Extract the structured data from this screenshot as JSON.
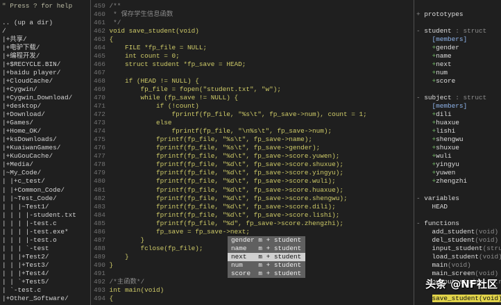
{
  "colors": {
    "background": "#1f1f1f",
    "tree_text": "#d4d4d4",
    "tree_hint": "#b9b9a2",
    "line_number": "#737373",
    "code": "#cfcb68",
    "comment": "#8b8b8b",
    "separator": "#505050",
    "popup_bg": "#606060",
    "popup_text": "#eeeeee",
    "popup_selected_bg": "#d0d0d0",
    "popup_selected_text": "#111111",
    "tag_text": "#dedede",
    "tag_dim": "#8e8e8e",
    "tag_group": "#8fb4ea",
    "tag_visibility": "#78c36a",
    "tag_current_bg": "#e2d44a",
    "tag_current_text": "#111111",
    "watermark": "#ffffff"
  },
  "nerdtree": {
    "lines": [
      "\" Press ? for help",
      "",
      ".. (up a dir)",
      "/",
      "|+共享/",
      "|+电驴下载/",
      "|+编程开发/",
      "|+$RECYCLE.BIN/",
      "|+baidu player/",
      "|+CloudCache/",
      "|+Cygwin/",
      "|+Cygwin_Download/",
      "|+desktop/",
      "|+Download/",
      "|+Games/",
      "|+Home_OK/",
      "|+ksDownloads/",
      "|+KuaiwanGames/",
      "|+KuGouCache/",
      "|+Media/",
      "|~My_Code/",
      "| |+c_test/",
      "| |+Common_Code/",
      "| |~Test_Code/",
      "| | |~Test1/",
      "| | | |-student.txt",
      "| | | |-test.c",
      "| | | |-test.exe*",
      "| | | |-test.o",
      "| | | `-test",
      "| | |+Test2/",
      "| | |+Test3/",
      "| | |+Test4/",
      "| | `+Test5/",
      "| `-test.c",
      "|+Other_Software/"
    ]
  },
  "editor": {
    "lines": [
      {
        "num": "459",
        "text": "/**",
        "comment": true
      },
      {
        "num": "460",
        "text": " * 保存学生信息函数",
        "comment": true
      },
      {
        "num": "461",
        "text": " */",
        "comment": true
      },
      {
        "num": "462",
        "text": "void save_student(void)"
      },
      {
        "num": "463",
        "text": "{"
      },
      {
        "num": "464",
        "text": "    FILE *fp_file = NULL;"
      },
      {
        "num": "465",
        "text": "    int count = 0;"
      },
      {
        "num": "466",
        "text": "    struct student *fp_save = HEAD;"
      },
      {
        "num": "467",
        "text": ""
      },
      {
        "num": "468",
        "text": "    if (HEAD != NULL) {"
      },
      {
        "num": "469",
        "text": "        fp_file = fopen(\"student.txt\", \"w\");"
      },
      {
        "num": "470",
        "text": "        while (fp_save != NULL) {"
      },
      {
        "num": "471",
        "text": "            if (!count)"
      },
      {
        "num": "472",
        "text": "                fprintf(fp_file, \"%s\\t\", fp_save->num), count = 1;"
      },
      {
        "num": "473",
        "text": "            else"
      },
      {
        "num": "474",
        "text": "                fprintf(fp_file, \"\\n%s\\t\", fp_save->num);"
      },
      {
        "num": "475",
        "text": "            fprintf(fp_file, \"%s\\t\", fp_save->name);"
      },
      {
        "num": "476",
        "text": "            fprintf(fp_file, \"%s\\t\", fp_save->gender);"
      },
      {
        "num": "477",
        "text": "            fprintf(fp_file, \"%d\\t\", fp_save->score.yuwen);"
      },
      {
        "num": "478",
        "text": "            fprintf(fp_file, \"%d\\t\", fp_save->score.shuxue);"
      },
      {
        "num": "479",
        "text": "            fprintf(fp_file, \"%d\\t\", fp_save->score.yingyu);"
      },
      {
        "num": "480",
        "text": "            fprintf(fp_file, \"%d\\t\", fp_save->score.wuli);"
      },
      {
        "num": "481",
        "text": "            fprintf(fp_file, \"%d\\t\", fp_save->score.huaxue);"
      },
      {
        "num": "482",
        "text": "            fprintf(fp_file, \"%d\\t\", fp_save->score.shengwu);"
      },
      {
        "num": "483",
        "text": "            fprintf(fp_file, \"%d\\t\", fp_save->score.dili);"
      },
      {
        "num": "484",
        "text": "            fprintf(fp_file, \"%d\\t\", fp_save->score.lishi);"
      },
      {
        "num": "485",
        "text": "            fprintf(fp_file, \"%d\", fp_save->score.zhengzhi);"
      },
      {
        "num": "486",
        "text": "            fp_save = fp_save->next;"
      },
      {
        "num": "487",
        "text": "        }"
      },
      {
        "num": "488",
        "text": "        fclose(fp_file);"
      },
      {
        "num": "489",
        "text": "    }"
      },
      {
        "num": "490",
        "text": "}"
      },
      {
        "num": "491",
        "text": ""
      },
      {
        "num": "492",
        "text": "/*主函数*/",
        "comment": true
      },
      {
        "num": "493",
        "text": "int main(void)"
      },
      {
        "num": "494",
        "text": "{"
      }
    ]
  },
  "completion_menu": {
    "items": [
      {
        "word": "gender",
        "kind": "m",
        "access": "+",
        "menu": "student"
      },
      {
        "word": "name",
        "kind": "m",
        "access": "+",
        "menu": "student"
      },
      {
        "word": "next",
        "kind": "m",
        "access": "+",
        "menu": "student",
        "selected": true
      },
      {
        "word": "num",
        "kind": "m",
        "access": "+",
        "menu": "student"
      },
      {
        "word": "score",
        "kind": "m",
        "access": "+",
        "menu": "student"
      }
    ]
  },
  "tagbar": {
    "lines": [
      {},
      {
        "fold": "+",
        "name": "prototypes"
      },
      {},
      {
        "fold": "-",
        "name": "student",
        "tail": " : struct"
      },
      {
        "group": "[members]"
      },
      {
        "vis": "+",
        "name": "gender"
      },
      {
        "vis": "+",
        "name": "name"
      },
      {
        "vis": "+",
        "name": "next"
      },
      {
        "vis": "+",
        "name": "num"
      },
      {
        "vis": "+",
        "name": "score"
      },
      {},
      {
        "fold": "-",
        "name": "subject",
        "tail": " : struct"
      },
      {
        "group": "[members]"
      },
      {
        "vis": "+",
        "name": "dili"
      },
      {
        "vis": "+",
        "name": "huaxue"
      },
      {
        "vis": "+",
        "name": "lishi"
      },
      {
        "vis": "+",
        "name": "shengwu"
      },
      {
        "vis": "+",
        "name": "shuxue"
      },
      {
        "vis": "+",
        "name": "wuli"
      },
      {
        "vis": "+",
        "name": "yingyu"
      },
      {
        "vis": "+",
        "name": "yuwen"
      },
      {
        "vis": "+",
        "name": "zhengzhi"
      },
      {},
      {
        "fold": "-",
        "name": "variables"
      },
      {
        "name": "HEAD"
      },
      {},
      {
        "fold": "-",
        "name": "functions"
      },
      {
        "name": "add_student",
        "sig": "(void)"
      },
      {
        "name": "del_student",
        "sig": "(void)"
      },
      {
        "name": "input_student",
        "sig": "(stru"
      },
      {
        "name": "load_student",
        "sig": "(void)"
      },
      {
        "name": "main",
        "sig": "(void)"
      },
      {
        "name": "main_screen",
        "sig": "(void)"
      },
      {
        "name": "output_student",
        "sig": "(str"
      },
      {},
      {
        "name": "save_student",
        "sig": "(void)",
        "current": true
      }
    ]
  },
  "watermark": {
    "brand": "头条",
    "handle": "@NF社区"
  }
}
